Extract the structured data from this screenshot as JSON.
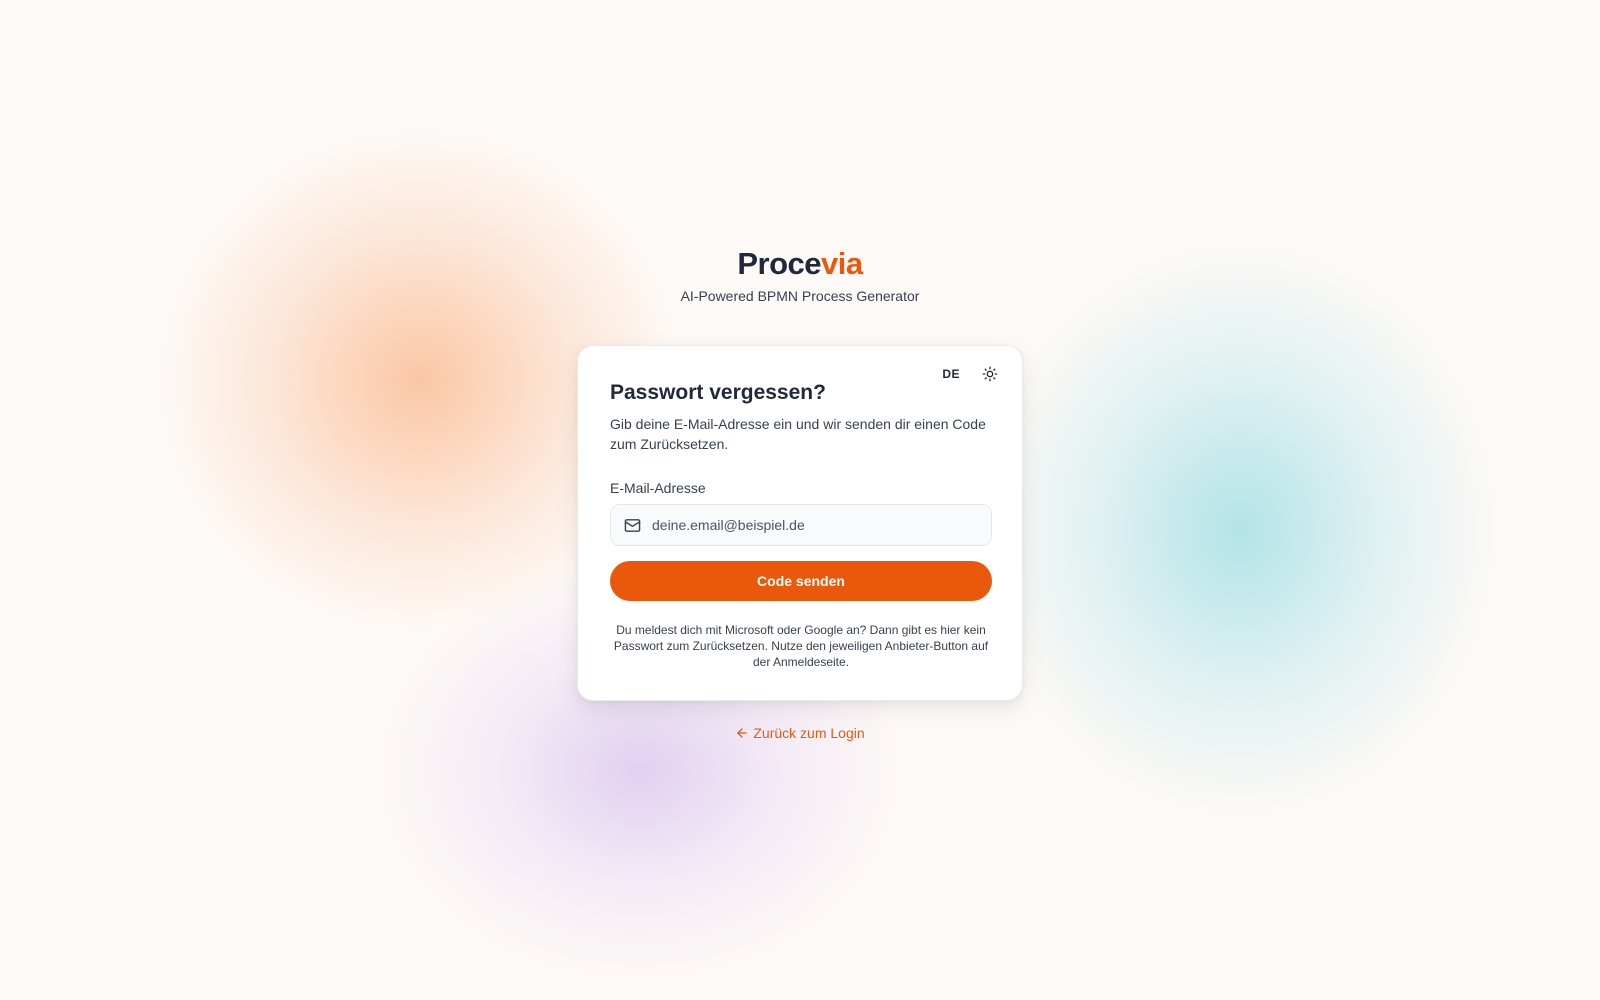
{
  "brand": {
    "logo_main": "Proce",
    "logo_accent": "via",
    "tagline": "AI-Powered BPMN Process Generator"
  },
  "colors": {
    "accent": "#ea580c",
    "text_dark": "#1e2a3b",
    "background": "#fdf9f6"
  },
  "card": {
    "language": "DE",
    "theme_icon": "sun-icon",
    "title": "Passwort vergessen?",
    "description": "Gib deine E-Mail-Adresse ein und wir senden dir einen Code zum Zurücksetzen.",
    "email_label": "E-Mail-Adresse",
    "email_icon": "mail-icon",
    "email_placeholder": "deine.email@beispiel.de",
    "email_value": "",
    "submit_label": "Code senden",
    "note": "Du meldest dich mit Microsoft oder Google an? Dann gibt es hier kein Passwort zum Zurücksetzen. Nutze den jeweiligen Anbieter-Button auf der Anmeldeseite."
  },
  "footer": {
    "back_icon": "arrow-left-icon",
    "back_label": "Zurück zum Login"
  }
}
